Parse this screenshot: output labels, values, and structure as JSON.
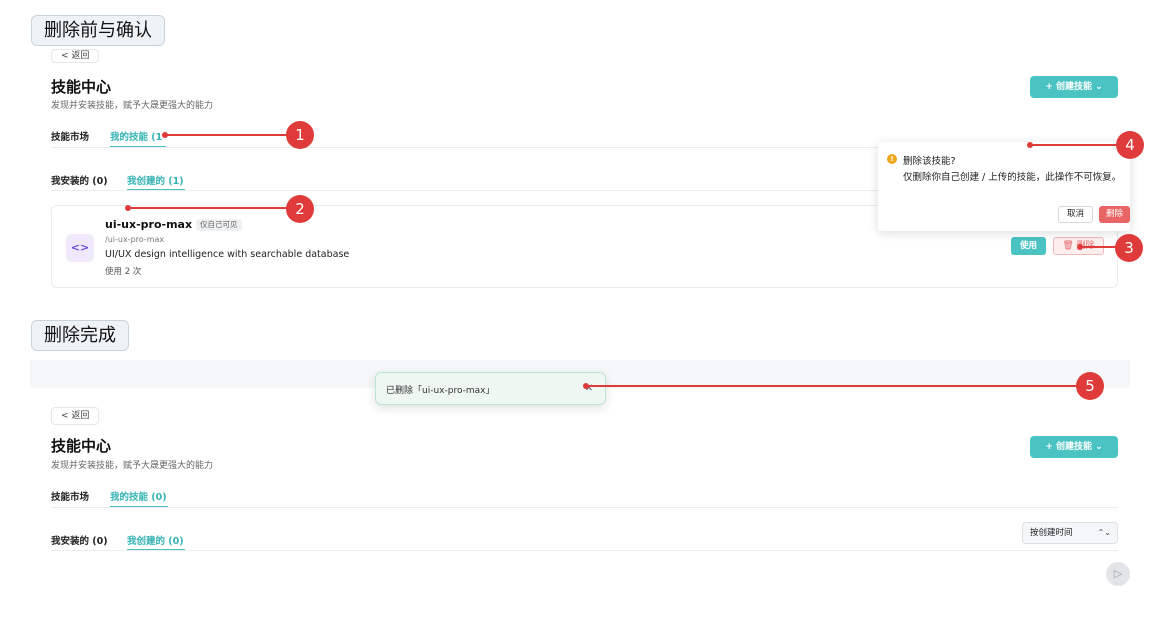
{
  "sections": {
    "before": "删除前与确认",
    "after": "删除完成"
  },
  "before": {
    "back": "< 返回",
    "title": "技能中心",
    "subtitle": "发现并安装技能，赋予大晟更强大的能力",
    "create_button": "+ 创建技能 ⌄",
    "tabs": [
      "技能市场",
      "我的技能 (1"
    ],
    "subtabs": [
      "我安装的 (0)",
      "我创建的 (1)"
    ],
    "card": {
      "icon": "code-icon",
      "name": "ui-ux-pro-max",
      "badge": "仅自己可见",
      "path": "/ui-ux-pro-max",
      "description": "UI/UX design intelligence with searchable database",
      "usage": "使用 2 次",
      "use_button": "使用",
      "delete_button": "🗑 删除"
    },
    "popover": {
      "title": "删除该技能?",
      "message": "仅删除你自己创建 / 上传的技能，此操作不可恢复。",
      "cancel": "取消",
      "confirm": "删除"
    }
  },
  "after": {
    "toast": "已删除「ui-ux-pro-max」",
    "toast_close": "✕",
    "back": "< 返回",
    "title": "技能中心",
    "subtitle": "发现并安装技能，赋予大晟更强大的能力",
    "create_button": "+ 创建技能 ⌄",
    "tabs": [
      "技能市场",
      "我的技能 (0)"
    ],
    "subtabs": [
      "我安装的 (0)",
      "我创建的 (0)"
    ],
    "sort": {
      "value": "按创建时间",
      "arrow": "⌃⌄"
    }
  },
  "callouts": [
    "1",
    "2",
    "3",
    "4",
    "5"
  ],
  "colors": {
    "accent": "#4cc3c3",
    "danger": "#e96565",
    "callout": "#e03b3b"
  }
}
